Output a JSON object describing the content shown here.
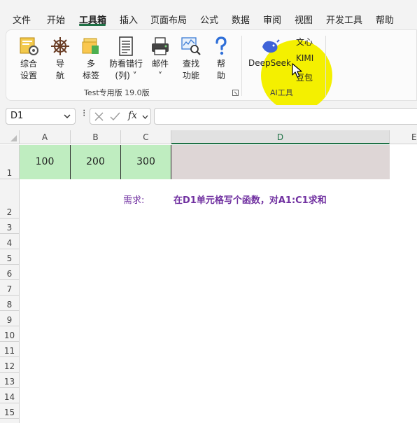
{
  "menu": {
    "items": [
      "文件",
      "开始",
      "工具箱",
      "插入",
      "页面布局",
      "公式",
      "数据",
      "审阅",
      "视图",
      "开发工具",
      "帮助"
    ],
    "active": "工具箱"
  },
  "ribbon": {
    "buttons": [
      {
        "line1": "综合",
        "line2": "设置",
        "icon": "settings-icon"
      },
      {
        "line1": "导",
        "line2": "航",
        "icon": "helm-wheel-icon"
      },
      {
        "line1": "多",
        "line2": "标签",
        "icon": "folders-icon"
      },
      {
        "line1": "防看错行",
        "line2": "(列) ˅",
        "icon": "document-rows-icon"
      },
      {
        "line1": "邮件",
        "line2": "˅",
        "icon": "printer-mail-icon"
      },
      {
        "line1": "查找",
        "line2": "功能",
        "icon": "find-icon"
      },
      {
        "line1": "帮",
        "line2": "助",
        "icon": "help-icon"
      }
    ],
    "group_label": "Test专用版 19.0版",
    "ai_group": {
      "deepseek": "DeepSeek",
      "wenxin": "文心",
      "kimi": "KIMI",
      "doubao": "豆包",
      "label": "AI工具"
    }
  },
  "formula_bar": {
    "name_box": "D1",
    "separator": "⁝",
    "fx": "fx",
    "formula": ""
  },
  "sheet": {
    "columns": [
      "A",
      "B",
      "C",
      "D",
      "E"
    ],
    "rows": [
      "1",
      "2",
      "3",
      "4",
      "5",
      "6",
      "7",
      "8",
      "9",
      "10",
      "11",
      "12",
      "13",
      "14",
      "15"
    ],
    "cells": {
      "A1": "100",
      "B1": "200",
      "C1": "300"
    },
    "note_label": "需求:",
    "note_text": "在D1单元格写个函数，对A1:C1求和"
  },
  "colors": {
    "accent": "#1e7145",
    "cell_fill": "#bfedc0",
    "selected_fill": "#ded6d6",
    "note": "#7030a0",
    "highlight": "#f4f000"
  }
}
